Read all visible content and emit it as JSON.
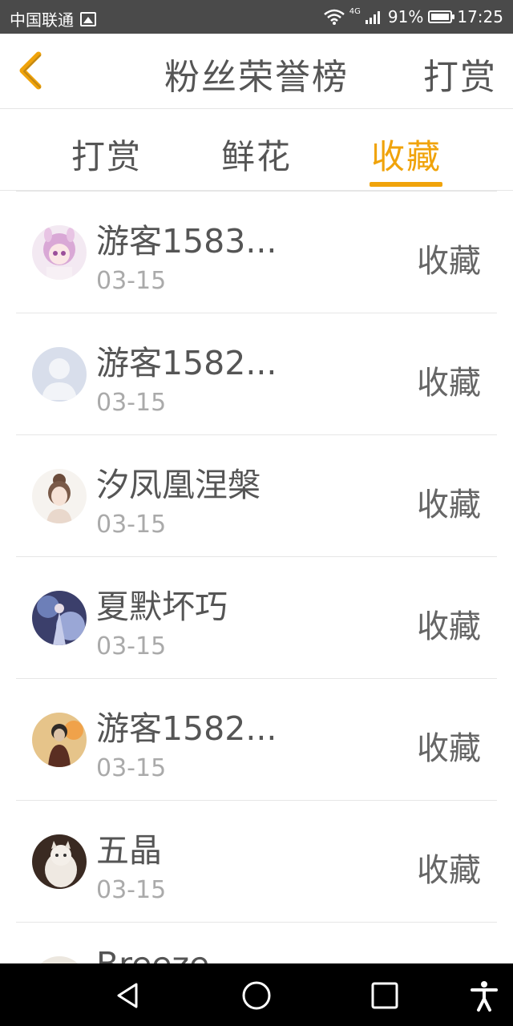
{
  "status_bar": {
    "carrier": "中国联通",
    "network": "4G",
    "battery": "91%",
    "time": "17:25"
  },
  "header": {
    "title": "粉丝荣誉榜",
    "action_label": "打赏"
  },
  "tabs": [
    {
      "label": "打赏",
      "active": false
    },
    {
      "label": "鲜花",
      "active": false
    },
    {
      "label": "收藏",
      "active": true
    }
  ],
  "list": [
    {
      "name": "游客1583...",
      "date": "03-15",
      "action": "收藏"
    },
    {
      "name": "游客1582...",
      "date": "03-15",
      "action": "收藏"
    },
    {
      "name": "汐凤凰涅槃",
      "date": "03-15",
      "action": "收藏"
    },
    {
      "name": "夏默坏巧",
      "date": "03-15",
      "action": "收藏"
    },
    {
      "name": "游客1582...",
      "date": "03-15",
      "action": "收藏"
    },
    {
      "name": "五晶",
      "date": "03-15",
      "action": "收藏"
    },
    {
      "name": "Breeze",
      "date": "",
      "action": ""
    }
  ],
  "colors": {
    "accent": "#f0a30a",
    "status_bar": "#4a4a4a",
    "text": "#555555",
    "muted": "#aaaaaa"
  },
  "icons": {
    "back": "chevron-left-icon",
    "nav_back": "triangle-back-icon",
    "nav_home": "circle-home-icon",
    "nav_recents": "square-recents-icon",
    "accessibility": "accessibility-icon"
  }
}
